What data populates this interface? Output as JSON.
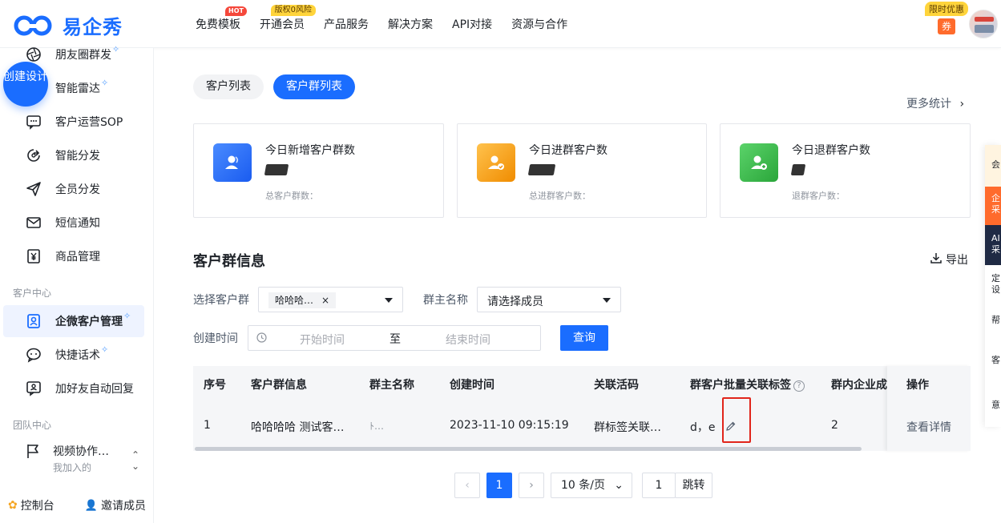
{
  "brand": {
    "name": "易企秀",
    "color": "#1a6dff"
  },
  "nav": {
    "items": [
      {
        "label": "免费模板",
        "badge": "HOT"
      },
      {
        "label": "开通会员",
        "badge": "版权0风险"
      },
      {
        "label": "产品服务",
        "badge": ""
      },
      {
        "label": "解决方案",
        "badge": ""
      },
      {
        "label": "API对接",
        "badge": ""
      },
      {
        "label": "资源与合作",
        "badge": ""
      }
    ],
    "promo_label": "限时优惠",
    "promo_coupon": "券"
  },
  "sidebar": {
    "create_button": "创建设计",
    "items": [
      {
        "label": "朋友圈群发",
        "icon": "aperture-icon",
        "spark": true
      },
      {
        "label": "智能雷达",
        "icon": "radar-icon",
        "spark": true
      },
      {
        "label": "客户运营SOP",
        "icon": "chat-dots-icon",
        "spark": false
      },
      {
        "label": "智能分发",
        "icon": "share-icon",
        "spark": false
      },
      {
        "label": "全员分发",
        "icon": "send-icon",
        "spark": false
      },
      {
        "label": "短信通知",
        "icon": "mail-icon",
        "spark": false
      },
      {
        "label": "商品管理",
        "icon": "yen-icon",
        "spark": false
      }
    ],
    "section_customer": "客户中心",
    "customer_items": [
      {
        "label": "企微客户管理",
        "icon": "contact-card-icon",
        "spark": true,
        "active": true
      },
      {
        "label": "快捷话术",
        "icon": "chat-bubble-icon",
        "spark": true
      },
      {
        "label": "加好友自动回复",
        "icon": "auto-reply-icon",
        "spark": false
      }
    ],
    "section_team": "团队中心",
    "team": {
      "name": "视频协作…",
      "sub": "我加入的"
    },
    "console": "控制台",
    "invite": "邀请成员"
  },
  "main": {
    "tabs": [
      {
        "label": "客户列表",
        "active": false
      },
      {
        "label": "客户群列表",
        "active": true
      }
    ],
    "more_stats": "更多统计",
    "cards": [
      {
        "title": "今日新增客户群数",
        "sub": "总客户群数：",
        "color": "#3d7cff"
      },
      {
        "title": "今日进群客户数",
        "sub": "总进群客户数：",
        "color": "#f5a623"
      },
      {
        "title": "今日退群客户数",
        "sub": "退群客户数：",
        "color": "#3bb54a"
      }
    ],
    "section_title": "客户群信息",
    "export_label": "导出",
    "filters": {
      "group_label": "选择客户群",
      "group_tag": "哈哈哈…",
      "owner_label": "群主名称",
      "owner_placeholder": "请选择成员",
      "time_label": "创建时间",
      "start_placeholder": "开始时间",
      "range_sep": "至",
      "end_placeholder": "结束时间",
      "query_button": "查询"
    },
    "table": {
      "headers": [
        "序号",
        "客户群信息",
        "群主名称",
        "创建时间",
        "关联活码",
        "群客户批量关联标签",
        "群内企业成",
        "操作"
      ],
      "row": {
        "index": "1",
        "group_info": "哈哈哈哈 测试客…",
        "owner": "ﾄ…",
        "created": "2023-11-10 09:15:19",
        "code": "群标签关联…",
        "tags": "d，e",
        "members": "2",
        "action": "查看详情"
      }
    },
    "pagination": {
      "prev": "‹",
      "current": "1",
      "next": "›",
      "page_size": "10 条/页",
      "jump_value": "1",
      "jump_label": "跳转"
    }
  },
  "float_bar": [
    "会",
    "企采",
    "AI采",
    "定设",
    "帮",
    "客",
    "意"
  ]
}
